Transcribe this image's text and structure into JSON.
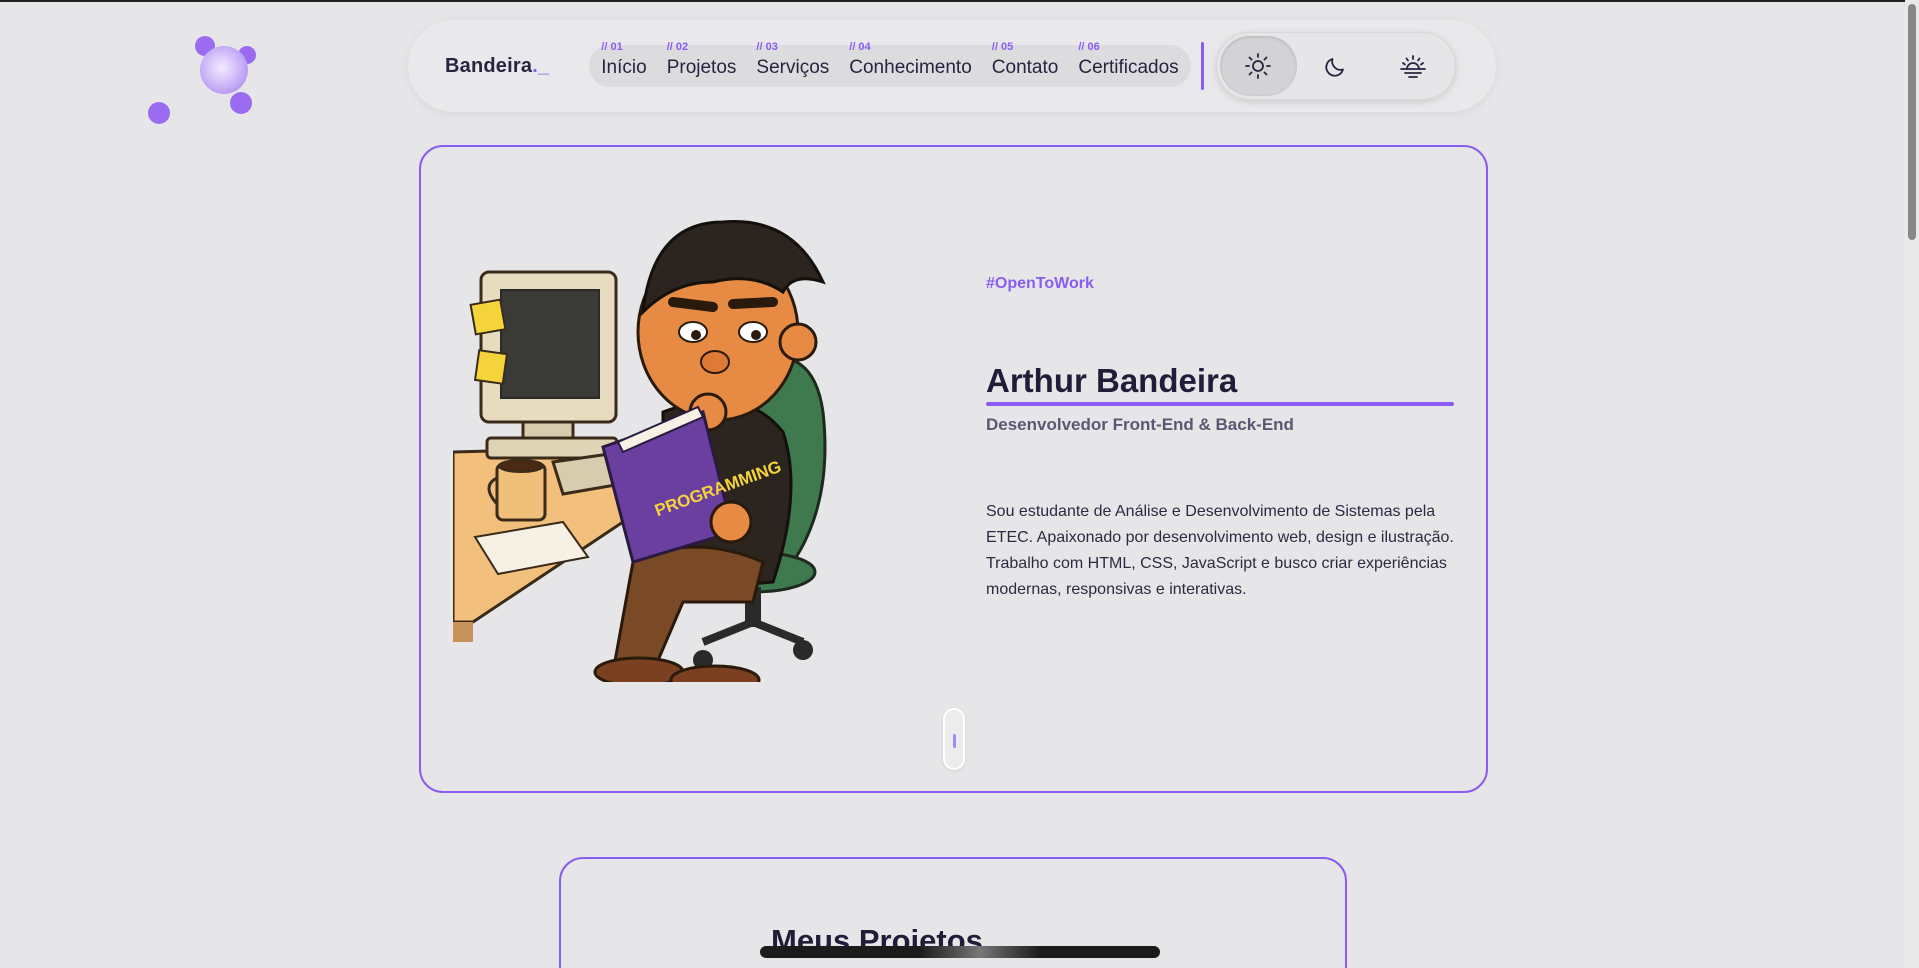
{
  "nav": {
    "brand": "Bandeira",
    "brand_suffix": "._",
    "items": [
      {
        "num": "// 01",
        "label": "Início"
      },
      {
        "num": "// 02",
        "label": "Projetos"
      },
      {
        "num": "// 03",
        "label": "Serviços"
      },
      {
        "num": "// 04",
        "label": "Conhecimento"
      },
      {
        "num": "// 05",
        "label": "Contato"
      },
      {
        "num": "// 06",
        "label": "Certificados"
      }
    ],
    "theme_buttons": [
      "sun-icon",
      "moon-icon",
      "sunset-icon"
    ],
    "active_theme": "sun-icon"
  },
  "hero": {
    "tag": "#OpenToWork",
    "name": "Arthur Bandeira",
    "role": "Desenvolvedor Front-End & Back-End",
    "bio": "Sou estudante de Análise e Desenvolvimento de Sistemas pela ETEC. Apaixonado por desenvolvimento web, design e ilustração. Trabalho com HTML, CSS, JavaScript e busco criar experiências modernas, responsivas e interativas.",
    "illustration_book_text": "PROGRAMMING"
  },
  "projects": {
    "title": "Meus Projetos"
  },
  "colors": {
    "accent": "#8a5cf2",
    "background": "#e6e6e8",
    "text": "#1f1d38"
  }
}
